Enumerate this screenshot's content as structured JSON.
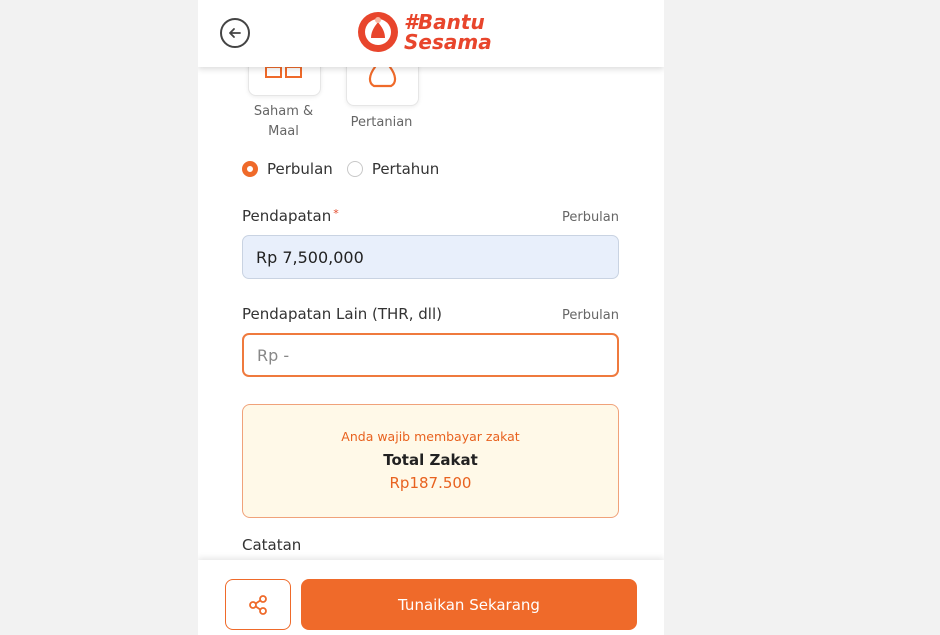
{
  "header": {
    "logo_line1": "#Bantu",
    "logo_line2": "Sesama"
  },
  "categories": [
    {
      "label_line1": "Saham &",
      "label_line2": "Maal",
      "icon": "building-icon"
    },
    {
      "label": "Pertanian",
      "icon": "sack-icon"
    }
  ],
  "period": {
    "options": [
      {
        "label": "Perbulan",
        "selected": true
      },
      {
        "label": "Pertahun",
        "selected": false
      }
    ]
  },
  "fields": {
    "pendapatan": {
      "label": "Pendapatan",
      "required_mark": "*",
      "note": "Perbulan",
      "value": "Rp 7,500,000"
    },
    "pendapatan_lain": {
      "label": "Pendapatan Lain (THR, dll)",
      "note": "Perbulan",
      "placeholder": "Rp -"
    }
  },
  "zakat": {
    "note": "Anda wajib membayar zakat",
    "title": "Total Zakat",
    "amount": "Rp187.500"
  },
  "catatan_label": "Catatan",
  "actions": {
    "pay_label": "Tunaikan Sekarang",
    "share_icon": "share-icon"
  },
  "colors": {
    "accent": "#ef6a2a",
    "logo_red": "#e8452c",
    "input_filled_bg": "#e8effb",
    "zakat_bg": "#fff9e8"
  }
}
